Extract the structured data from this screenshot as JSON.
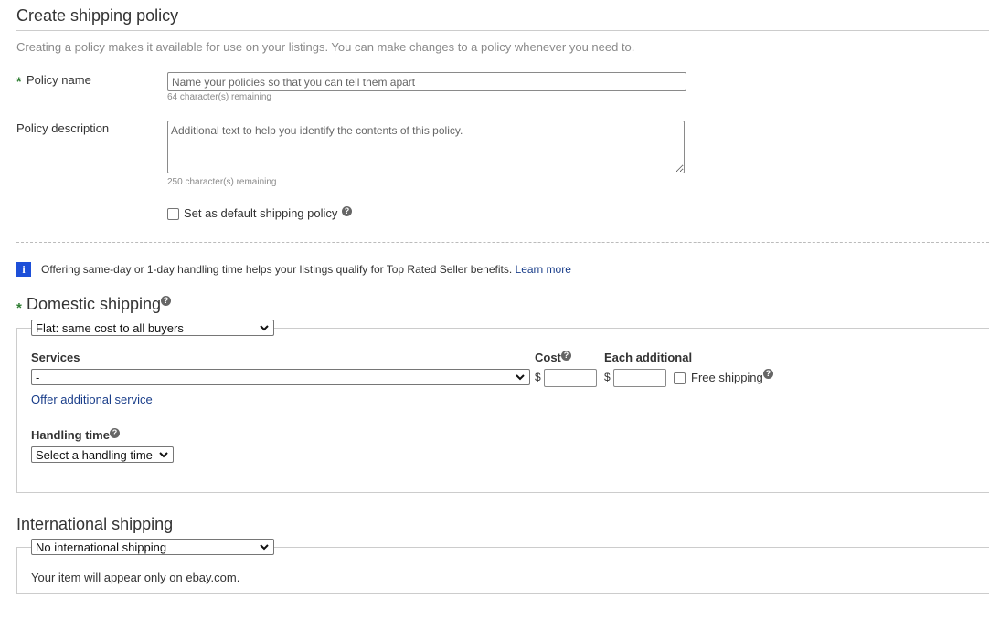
{
  "page": {
    "title": "Create shipping policy",
    "intro": "Creating a policy makes it available for use on your listings. You can make changes to a policy whenever you need to."
  },
  "policy_name": {
    "label": "Policy name",
    "required_mark": "*",
    "placeholder": "Name your policies so that you can tell them apart",
    "remaining": "64 character(s) remaining"
  },
  "policy_description": {
    "label": "Policy description",
    "placeholder": "Additional text to help you identify the contents of this policy.",
    "remaining": "250 character(s) remaining"
  },
  "default_policy": {
    "label": "Set as default shipping policy",
    "help_icon": "question-icon"
  },
  "info_banner": {
    "icon": "info-icon",
    "text": "Offering same-day or 1-day handling time helps your listings qualify for Top Rated Seller benefits.",
    "link": "Learn more"
  },
  "domestic": {
    "required_mark": "*",
    "title": "Domestic shipping",
    "cost_type_selected": "Flat: same cost to all buyers",
    "services_label": "Services",
    "service_selected": "-",
    "cost_label": "Cost",
    "currency": "$",
    "each_additional_label": "Each additional",
    "free_shipping_label": "Free shipping",
    "offer_additional_link": "Offer additional service",
    "handling_time_label": "Handling time",
    "handling_time_selected": "Select a handling time"
  },
  "international": {
    "title": "International shipping",
    "selected": "No international shipping",
    "note": "Your item will appear only on ebay.com."
  },
  "colors": {
    "required": "#2e7d32",
    "link": "#1a3e8a",
    "info_icon": "#1d4fd8"
  }
}
